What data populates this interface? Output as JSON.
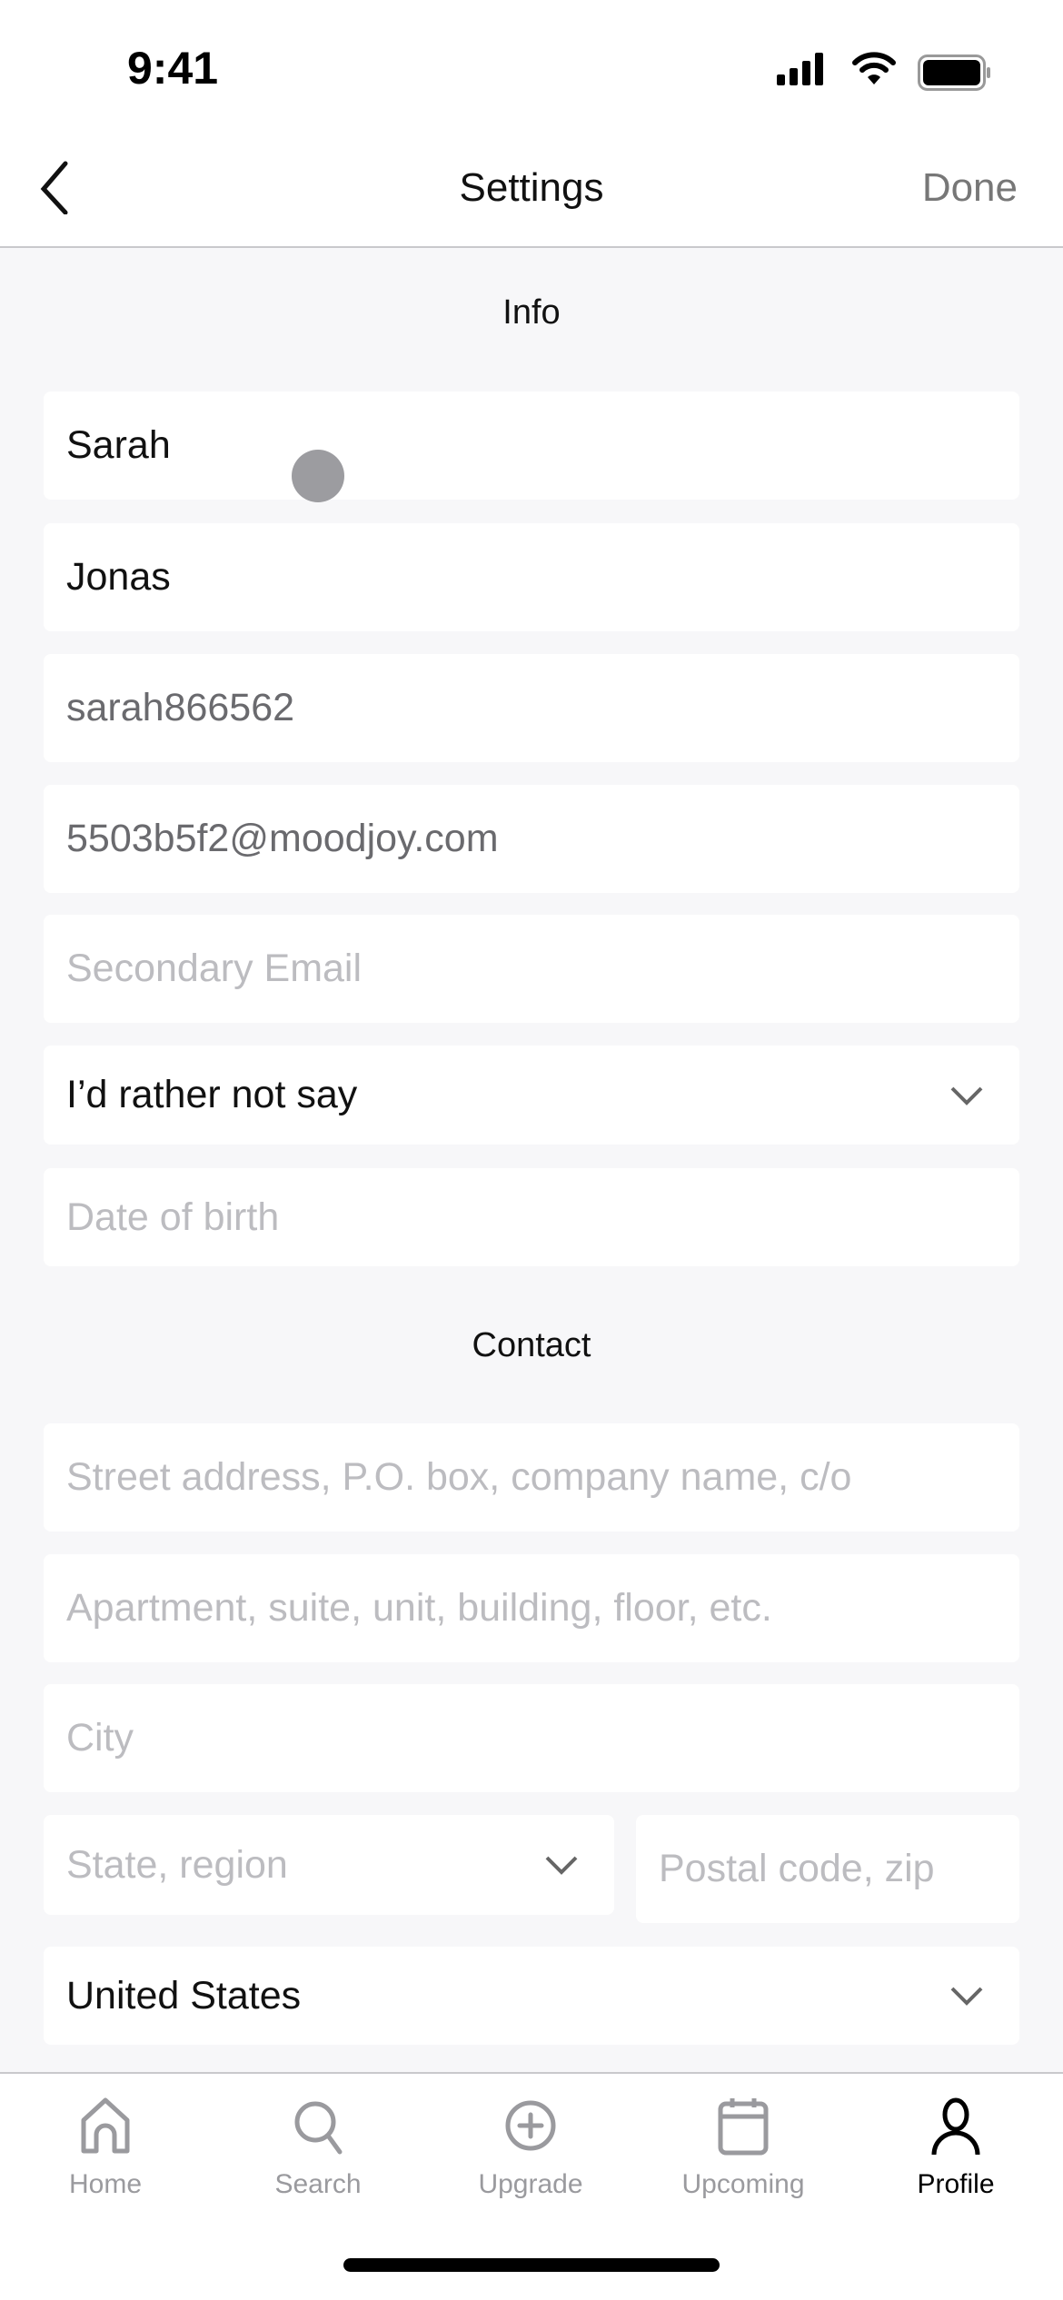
{
  "status_bar": {
    "time": "9:41"
  },
  "nav": {
    "title": "Settings",
    "done_label": "Done"
  },
  "info": {
    "section_label": "Info",
    "first_name": "Sarah",
    "last_name": "Jonas",
    "username": "sarah866562",
    "email": "5503b5f2@moodjoy.com",
    "secondary_email_placeholder": "Secondary Email",
    "gender_selected": "I’d rather not say",
    "dob_placeholder": "Date of birth"
  },
  "contact": {
    "section_label": "Contact",
    "street_placeholder": "Street address, P.O. box, company name, c/o",
    "apt_placeholder": "Apartment, suite, unit, building, floor, etc.",
    "city_placeholder": "City",
    "state_placeholder": "State, region",
    "postal_placeholder": "Postal code, zip",
    "country_selected": "United States"
  },
  "tabs": [
    {
      "label": "Home",
      "icon": "home-icon",
      "active": false
    },
    {
      "label": "Search",
      "icon": "search-icon",
      "active": false
    },
    {
      "label": "Upgrade",
      "icon": "plus-circle-icon",
      "active": false
    },
    {
      "label": "Upcoming",
      "icon": "calendar-icon",
      "active": false
    },
    {
      "label": "Profile",
      "icon": "person-icon",
      "active": true
    }
  ]
}
